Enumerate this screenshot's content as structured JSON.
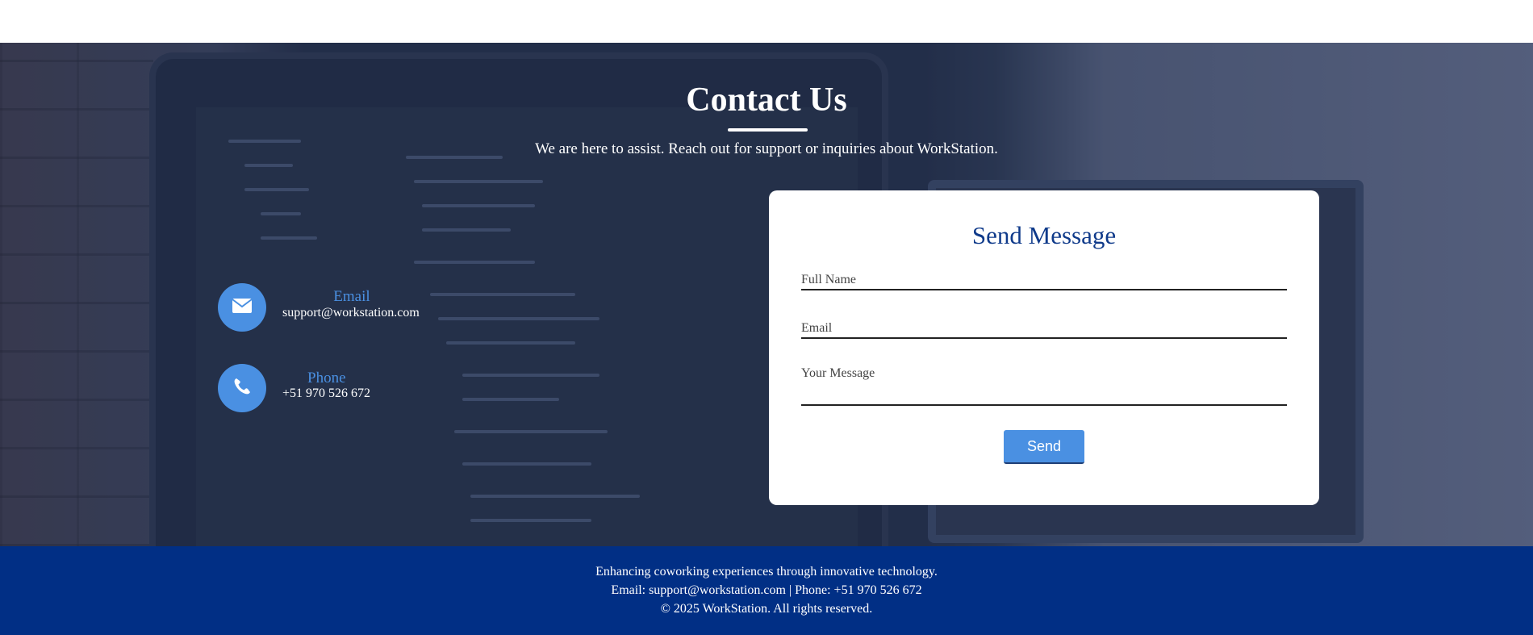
{
  "contact": {
    "title": "Contact Us",
    "subtitle": "We are here to assist. Reach out for support or inquiries about WorkStation."
  },
  "info": {
    "email": {
      "label": "Email",
      "value": "support@workstation.com",
      "icon": "envelope-icon"
    },
    "phone": {
      "label": "Phone",
      "value": "+51 970 526 672",
      "icon": "phone-icon"
    }
  },
  "form": {
    "title": "Send Message",
    "full_name_placeholder": "Full Name",
    "email_placeholder": "Email",
    "message_placeholder": "Your Message",
    "send_label": "Send"
  },
  "footer": {
    "tagline": "Enhancing coworking experiences through innovative technology.",
    "contact_line": "Email: support@workstation.com | Phone: +51 970 526 672",
    "copyright": "© 2025 WorkStation. All rights reserved."
  },
  "colors": {
    "accent": "#4a90e2",
    "brand_dark": "#012f85",
    "card_title": "#0f3a8a"
  }
}
